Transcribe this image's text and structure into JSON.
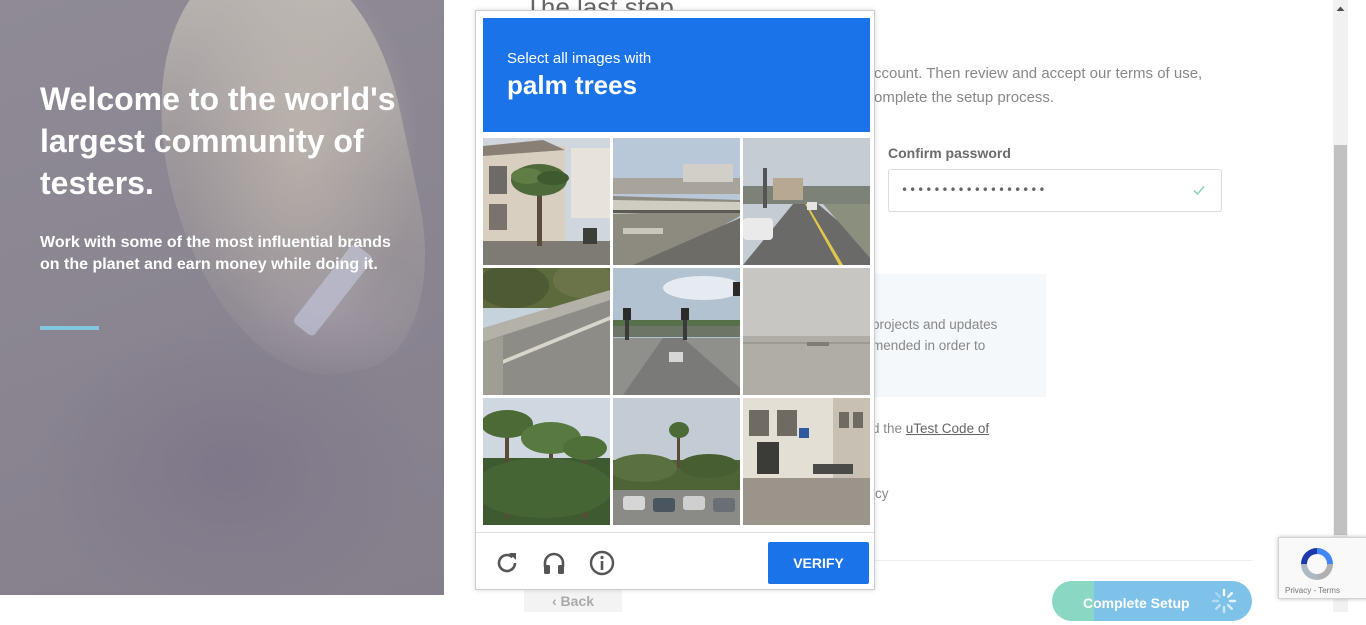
{
  "hero": {
    "title": "Welcome to the world's largest community of testers.",
    "subtitle": "Work with some of the most influential brands on the planet and earn money while doing it.",
    "accent_color": "#7fc8e0"
  },
  "form": {
    "heading": "The last step",
    "intro": "ccount. Then review and accept our terms of use, omplete the setup process.",
    "confirm_label": "Confirm password",
    "confirm_value": "••••••••••••••••••",
    "info_text": "projects and updates mended in order to",
    "coc_prefix": "d the ",
    "coc_link": "uTest Code of",
    "policy_fragment": "icy",
    "back_label": "Back",
    "complete_label": "Complete Setup"
  },
  "captcha": {
    "instruction": "Select all images with",
    "target": "palm trees",
    "verify_label": "VERIFY",
    "header_color": "#1a73e8",
    "tiles": [
      {
        "name": "tile-house-palm"
      },
      {
        "name": "tile-bridge-overpass"
      },
      {
        "name": "tile-street-road"
      },
      {
        "name": "tile-highway-curve"
      },
      {
        "name": "tile-intersection-lights"
      },
      {
        "name": "tile-foggy-water"
      },
      {
        "name": "tile-palm-trees"
      },
      {
        "name": "tile-parking-palms"
      },
      {
        "name": "tile-building-street"
      }
    ],
    "icons": [
      "reload-icon",
      "headphones-icon",
      "info-icon"
    ]
  },
  "recaptcha_badge": {
    "terms": "Privacy - Terms"
  }
}
